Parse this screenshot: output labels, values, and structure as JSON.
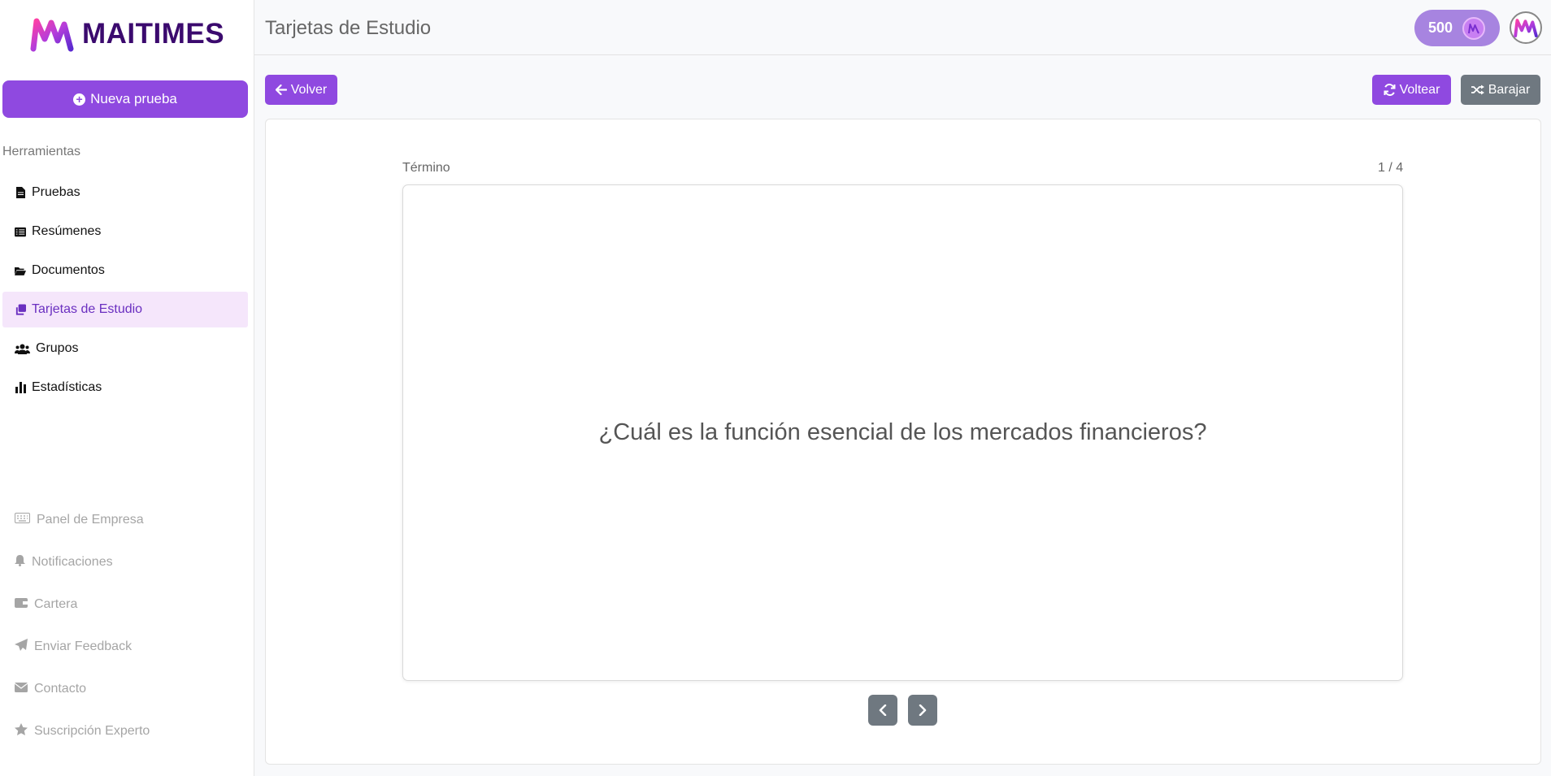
{
  "brand": {
    "name": "MAITIMES"
  },
  "sidebar": {
    "new_button": "Nueva prueba",
    "section_label": "Herramientas",
    "items": [
      {
        "label": "Pruebas",
        "icon": "file-icon"
      },
      {
        "label": "Resúmenes",
        "icon": "list-icon"
      },
      {
        "label": "Documentos",
        "icon": "folder-icon"
      },
      {
        "label": "Tarjetas de Estudio",
        "icon": "cards-icon",
        "active": true
      },
      {
        "label": "Grupos",
        "icon": "users-icon"
      },
      {
        "label": "Estadísticas",
        "icon": "chart-icon"
      }
    ],
    "footer_items": [
      {
        "label": "Panel de Empresa",
        "icon": "keyboard-icon"
      },
      {
        "label": "Notificaciones",
        "icon": "bell-icon"
      },
      {
        "label": "Cartera",
        "icon": "wallet-icon"
      },
      {
        "label": "Enviar Feedback",
        "icon": "send-icon"
      },
      {
        "label": "Contacto",
        "icon": "envelope-icon"
      },
      {
        "label": "Suscripción Experto",
        "icon": "star-icon"
      }
    ]
  },
  "header": {
    "title": "Tarjetas de Estudio",
    "coins": "500"
  },
  "toolbar": {
    "back_label": "Volver",
    "flip_label": "Voltear",
    "shuffle_label": "Barajar"
  },
  "flashcard": {
    "side_label": "Término",
    "counter": "1 / 4",
    "text": "¿Cuál es la función esencial de los mercados financieros?"
  },
  "colors": {
    "accent": "#8f49e0",
    "active_bg": "#f5e6fb",
    "secondary": "#6f7880"
  }
}
